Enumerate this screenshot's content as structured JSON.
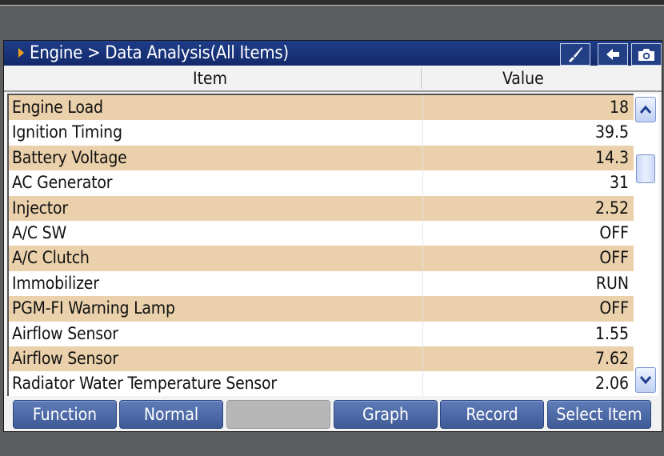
{
  "header": {
    "breadcrumb": "Engine > Data Analysis(All Items)",
    "icons": [
      "brush-icon",
      "back-arrow-icon",
      "camera-icon"
    ]
  },
  "columns": {
    "item": "Item",
    "value": "Value"
  },
  "rows": [
    {
      "item": "Engine Load",
      "value": "18"
    },
    {
      "item": "Ignition Timing",
      "value": "39.5"
    },
    {
      "item": "Battery Voltage",
      "value": "14.3"
    },
    {
      "item": "AC Generator",
      "value": "31"
    },
    {
      "item": "Injector",
      "value": "2.52"
    },
    {
      "item": "A/C SW",
      "value": "OFF"
    },
    {
      "item": "A/C Clutch",
      "value": "OFF"
    },
    {
      "item": "Immobilizer",
      "value": "RUN"
    },
    {
      "item": "PGM-FI Warning Lamp",
      "value": "OFF"
    },
    {
      "item": "Airflow Sensor",
      "value": "1.55"
    },
    {
      "item": "Airflow Sensor",
      "value": "7.62"
    },
    {
      "item": "Radiator Water Temperature Sensor",
      "value": "2.06"
    }
  ],
  "buttons": {
    "function": "Function",
    "normal": "Normal",
    "blank": "",
    "graph": "Graph",
    "record": "Record",
    "select_item": "Select Item"
  },
  "colors": {
    "titlebar": "#13296b",
    "row_alt": "#ead1ac",
    "button": "#4a66a3",
    "accent_arrow": "#f0a020"
  }
}
